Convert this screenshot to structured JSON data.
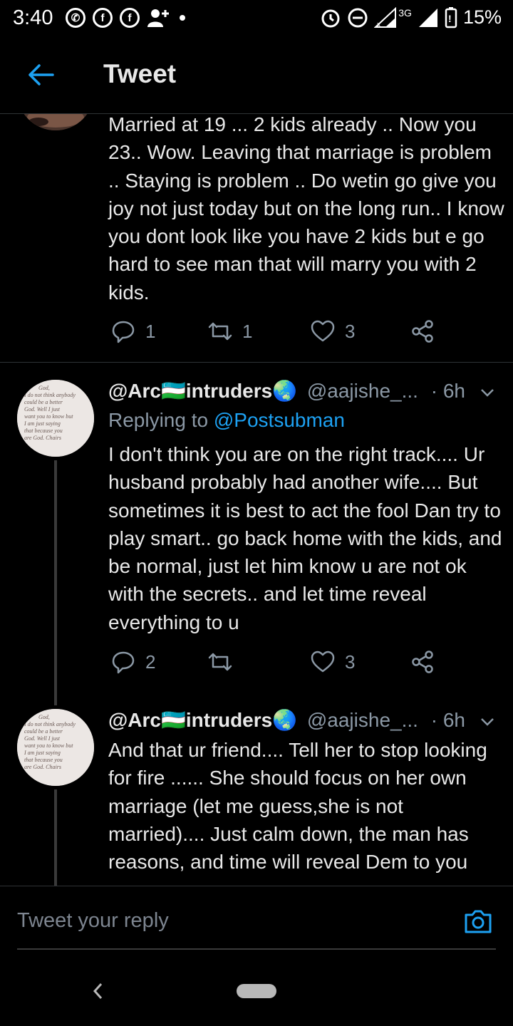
{
  "status_bar": {
    "time": "3:40",
    "icons_left": [
      "whatsapp-icon",
      "facebook-icon",
      "facebook-icon",
      "add-user-icon",
      "dot-icon"
    ],
    "network": "3G",
    "battery": "15%",
    "icons_right": [
      "alarm-icon",
      "do-not-disturb-icon",
      "signal-icon",
      "battery-icon"
    ]
  },
  "header": {
    "title": "Tweet",
    "accent_color": "#1da1f2"
  },
  "tweets": [
    {
      "text": "Married at 19 ... 2 kids already .. Now you 23.. Wow. Leaving that marriage is problem .. Staying is problem .. Do wetin go give you joy not just today but on the long run.. I know you dont look like you have 2 kids but e go hard to see man that will marry you with 2 kids.",
      "replies": "1",
      "retweets": "1",
      "likes": "3"
    },
    {
      "name": "@Arc🇺🇿intruders🌏",
      "handle": "@aajishe_...",
      "time": "· 6h",
      "replying_prefix": "Replying to ",
      "replying_to": "@Postsubman",
      "text": "I don't think you are on the right track.... Ur husband probably had another wife.... But sometimes it is best to act the fool Dan try to play smart.. go back home with the kids, and be normal, just let him know u are not ok with the secrets.. and let time reveal everything to u",
      "replies": "2",
      "likes": "3",
      "avatar_text": "God, I do not think anybody could be a better God. Well I just want you to know but I am just saying that because you are God. Chairs"
    },
    {
      "name": "@Arc🇺🇿intruders🌏",
      "handle": "@aajishe_...",
      "time": "· 6h",
      "text": "And that ur friend.... Tell her to stop looking for fire ...... She should focus on her own marriage (let me guess,she is not married).... Just calm down, the man has reasons, and time will reveal Dem to you"
    }
  ],
  "reply_bar": {
    "placeholder": "Tweet your reply"
  }
}
